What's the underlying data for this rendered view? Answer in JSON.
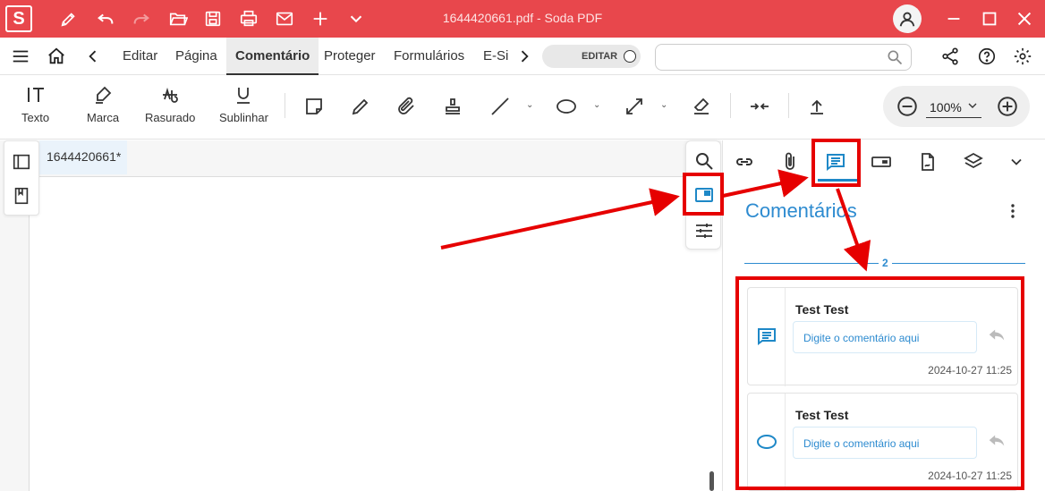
{
  "window": {
    "title": "1644420661.pdf  -  Soda PDF",
    "logo_letter": "S",
    "colors": {
      "titlebar": "#e8474c",
      "accent": "#2d8bd0",
      "highlight": "#e60000"
    }
  },
  "title_toolbar_icons": [
    "pen-icon",
    "undo-icon",
    "redo-icon",
    "open-folder-icon",
    "save-icon",
    "print-icon",
    "mail-icon",
    "plus-icon",
    "chevron-down-icon"
  ],
  "menu": {
    "tabs": [
      {
        "label": "Editar",
        "active": false
      },
      {
        "label": "Página",
        "active": false
      },
      {
        "label": "Comentário",
        "active": true
      },
      {
        "label": "Proteger",
        "active": false
      },
      {
        "label": "Formulários",
        "active": false
      },
      {
        "label": "E-Si",
        "active": false
      }
    ],
    "edit_toggle_label": "EDITAR",
    "search_value": ""
  },
  "toolbar": {
    "text_tools": [
      {
        "label": "Texto"
      },
      {
        "label": "Marca"
      },
      {
        "label": "Rasurado"
      },
      {
        "label": "Sublinhar"
      }
    ],
    "zoom_value": "100%"
  },
  "document": {
    "tab_label": "1644420661*"
  },
  "panel": {
    "title": "Comentários",
    "count": "2",
    "comments": [
      {
        "author": "Test Test",
        "reply_placeholder": "Digite o comentário aqui",
        "timestamp": "2024-10-27 11:25",
        "icon": "comment-icon"
      },
      {
        "author": "Test Test",
        "reply_placeholder": "Digite o comentário aqui",
        "timestamp": "2024-10-27 11:25",
        "icon": "ellipse-icon"
      }
    ]
  }
}
